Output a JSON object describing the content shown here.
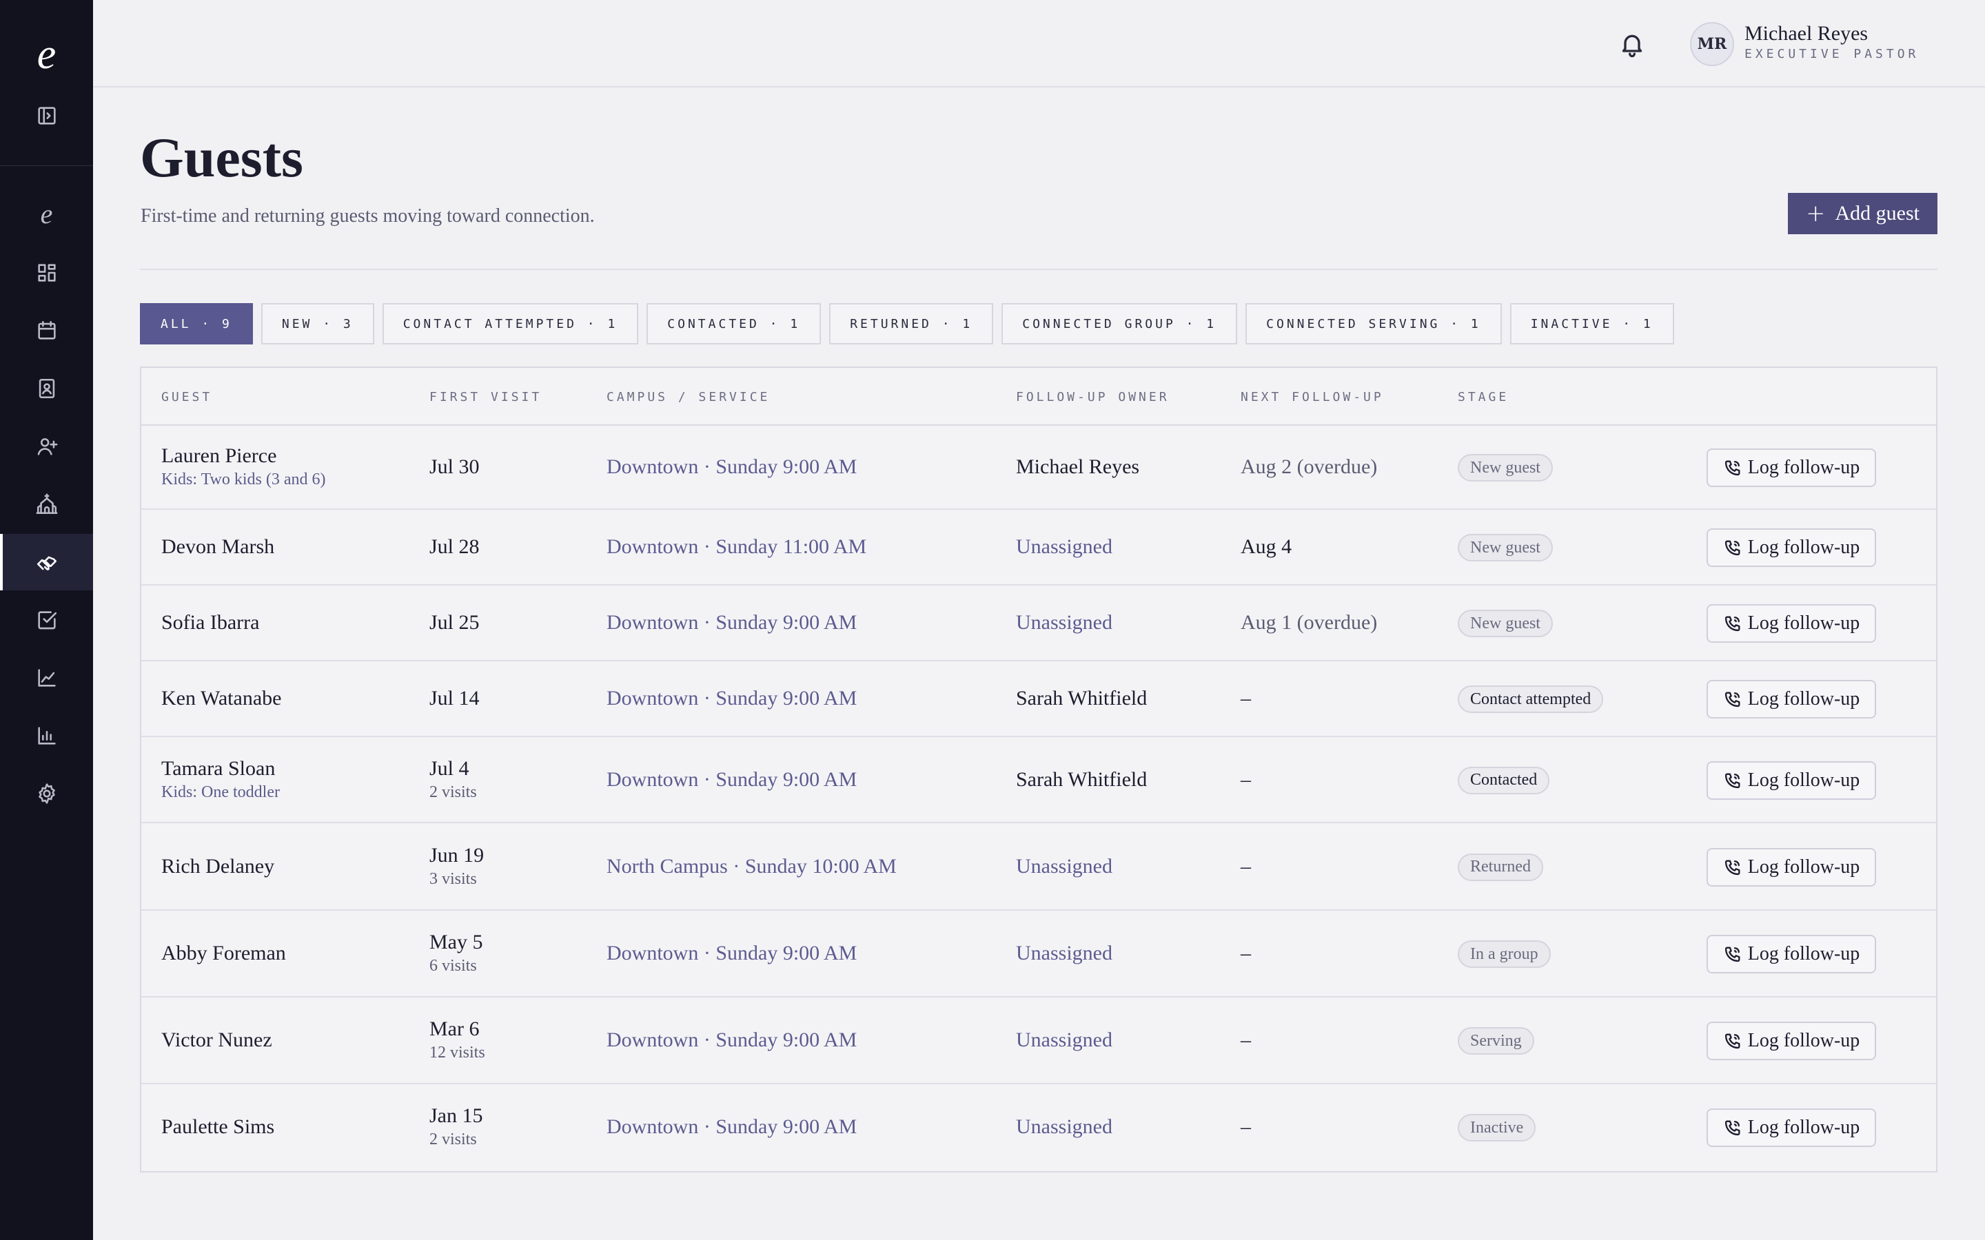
{
  "app": {
    "logo_glyph": "e"
  },
  "user": {
    "initials": "MR",
    "name": "Michael Reyes",
    "role": "EXECUTIVE PASTOR"
  },
  "page": {
    "title": "Guests",
    "subtitle": "First-time and returning guests moving toward connection.",
    "add_button": "Add guest",
    "add_button_icon": "plus-icon"
  },
  "filters": [
    {
      "label": "ALL · 9",
      "active": true
    },
    {
      "label": "NEW · 3",
      "active": false
    },
    {
      "label": "CONTACT ATTEMPTED · 1",
      "active": false
    },
    {
      "label": "CONTACTED · 1",
      "active": false
    },
    {
      "label": "RETURNED · 1",
      "active": false
    },
    {
      "label": "CONNECTED GROUP · 1",
      "active": false
    },
    {
      "label": "CONNECTED SERVING · 1",
      "active": false
    },
    {
      "label": "INACTIVE · 1",
      "active": false
    }
  ],
  "table": {
    "headers": {
      "guest": "GUEST",
      "first_visit": "FIRST VISIT",
      "campus": "CAMPUS / SERVICE",
      "owner": "FOLLOW-UP OWNER",
      "next": "NEXT FOLLOW-UP",
      "stage": "STAGE"
    },
    "action_label": "Log follow-up",
    "rows": [
      {
        "name": "Lauren Pierce",
        "sub": "Kids: Two kids (3 and 6)",
        "date": "Jul 30",
        "visits": "",
        "campus": "Downtown · Sunday 9:00 AM",
        "owner": "Michael Reyes",
        "owner_assigned": true,
        "next": "Aug 2 (overdue)",
        "next_dark": false,
        "stage": "New guest",
        "stage_dark": false
      },
      {
        "name": "Devon Marsh",
        "sub": "",
        "date": "Jul 28",
        "visits": "",
        "campus": "Downtown · Sunday 11:00 AM",
        "owner": "Unassigned",
        "owner_assigned": false,
        "next": "Aug 4",
        "next_dark": true,
        "stage": "New guest",
        "stage_dark": false
      },
      {
        "name": "Sofia Ibarra",
        "sub": "",
        "date": "Jul 25",
        "visits": "",
        "campus": "Downtown · Sunday 9:00 AM",
        "owner": "Unassigned",
        "owner_assigned": false,
        "next": "Aug 1 (overdue)",
        "next_dark": false,
        "stage": "New guest",
        "stage_dark": false
      },
      {
        "name": "Ken Watanabe",
        "sub": "",
        "date": "Jul 14",
        "visits": "",
        "campus": "Downtown · Sunday 9:00 AM",
        "owner": "Sarah Whitfield",
        "owner_assigned": true,
        "next": "–",
        "next_dark": true,
        "stage": "Contact attempted",
        "stage_dark": true
      },
      {
        "name": "Tamara Sloan",
        "sub": "Kids: One toddler",
        "date": "Jul 4",
        "visits": "2 visits",
        "campus": "Downtown · Sunday 9:00 AM",
        "owner": "Sarah Whitfield",
        "owner_assigned": true,
        "next": "–",
        "next_dark": true,
        "stage": "Contacted",
        "stage_dark": true
      },
      {
        "name": "Rich Delaney",
        "sub": "",
        "date": "Jun 19",
        "visits": "3 visits",
        "campus": "North Campus · Sunday 10:00 AM",
        "owner": "Unassigned",
        "owner_assigned": false,
        "next": "–",
        "next_dark": true,
        "stage": "Returned",
        "stage_dark": false
      },
      {
        "name": "Abby Foreman",
        "sub": "",
        "date": "May 5",
        "visits": "6 visits",
        "campus": "Downtown · Sunday 9:00 AM",
        "owner": "Unassigned",
        "owner_assigned": false,
        "next": "–",
        "next_dark": true,
        "stage": "In a group",
        "stage_dark": false
      },
      {
        "name": "Victor Nunez",
        "sub": "",
        "date": "Mar 6",
        "visits": "12 visits",
        "campus": "Downtown · Sunday 9:00 AM",
        "owner": "Unassigned",
        "owner_assigned": false,
        "next": "–",
        "next_dark": true,
        "stage": "Serving",
        "stage_dark": false
      },
      {
        "name": "Paulette Sims",
        "sub": "",
        "date": "Jan 15",
        "visits": "2 visits",
        "campus": "Downtown · Sunday 9:00 AM",
        "owner": "Unassigned",
        "owner_assigned": false,
        "next": "–",
        "next_dark": true,
        "stage": "Inactive",
        "stage_dark": false
      }
    ]
  },
  "sidebar": {
    "items": [
      {
        "icon": "home-logo-icon",
        "active": false
      },
      {
        "icon": "dashboard-grid-icon",
        "active": false
      },
      {
        "icon": "calendar-icon",
        "active": false
      },
      {
        "icon": "contact-card-icon",
        "active": false
      },
      {
        "icon": "add-person-icon",
        "active": false
      },
      {
        "icon": "church-icon",
        "active": false
      },
      {
        "icon": "handshake-icon",
        "active": true
      },
      {
        "icon": "checkbox-icon",
        "active": false
      },
      {
        "icon": "line-chart-icon",
        "active": false
      },
      {
        "icon": "bar-chart-icon",
        "active": false
      },
      {
        "icon": "settings-gear-icon",
        "active": false
      }
    ]
  },
  "colors": {
    "sidebar_bg": "#12121f",
    "accent": "#4d4b7c",
    "chip_active": "#5a5890",
    "link_text": "#5c5b8f"
  }
}
